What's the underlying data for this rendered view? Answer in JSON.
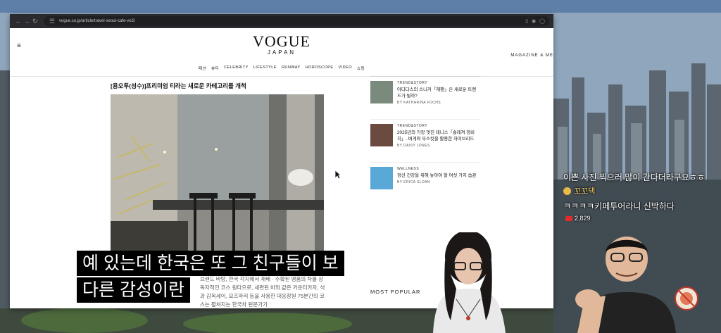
{
  "browser": {
    "url": "vogue.co.jp/article/travel-seoul-cafe-vol3",
    "icons": [
      "arrow-left-icon",
      "arrow-right-icon",
      "reload-icon",
      "site-info-icon",
      "translate-icon",
      "privacy-icon",
      "extensions-icon"
    ]
  },
  "header": {
    "logo_main": "VOGUE",
    "logo_sub": "JAPAN",
    "magazine": "MAGAZINE & ME",
    "menu": [
      "패션",
      "뷰티",
      "CELEBRITY",
      "LIFESTYLE",
      "RUNWAY",
      "HOROSCOPE",
      "VIDEO",
      "쇼핑"
    ]
  },
  "article": {
    "title": "[용오투(성수)]프리미엄 티라는 새로운 카테고리를 개척",
    "body": "브랜드 바탕, 한국 각지에서 재배 · 수확된 명품의 차를 상독자적인 코스 원타으로, 세련된 바와 같은 카운터카자, 석과 감옥세이, 요즈마리 등을 사용한 대응장원 75분간의 코스는 펼쳐지는 한국차 된문가기"
  },
  "sidebar": {
    "stories": [
      {
        "category": "TREND&STORY",
        "headline": "아디다스의 스니커「재팬」은 새로운 트렌드가 될까?",
        "byline": "BY KATHARINA FOCHS",
        "thumb_color": "#7a8a7c"
      },
      {
        "category": "TREND&STORY",
        "headline": "2025년의 가장 멋진 테니스「슬레져 정비치」. 버게와 무스킷을 활용한 하이브리드",
        "byline": "BY DAISY JONES",
        "thumb_color": "#6b4a3f"
      },
      {
        "category": "WELLNESS",
        "headline": "정신 건강을 위해 놓아야 할 여섯 가지 습관",
        "byline": "BY ERICA SLOAN",
        "thumb_color": "#5aa8d8"
      }
    ],
    "most_popular": "MOST POPULAR"
  },
  "subtitle": {
    "line1": "예 있는데 한국은 또 그 친구들이 보",
    "line2": "다른 감성이란"
  },
  "chat": {
    "message1": "이쁜 사진 찍으러 많이 간다더라구요ㅎㅎ",
    "user2": "꼬꼬댁",
    "message3": "ㅋㅋㅋㅋ키페투어라니 신박하다",
    "count": "2,829"
  },
  "colors": {
    "subtitle_bg": "#000000",
    "chat_name": "#f5d36a",
    "youtube_red": "#e52a2a"
  }
}
